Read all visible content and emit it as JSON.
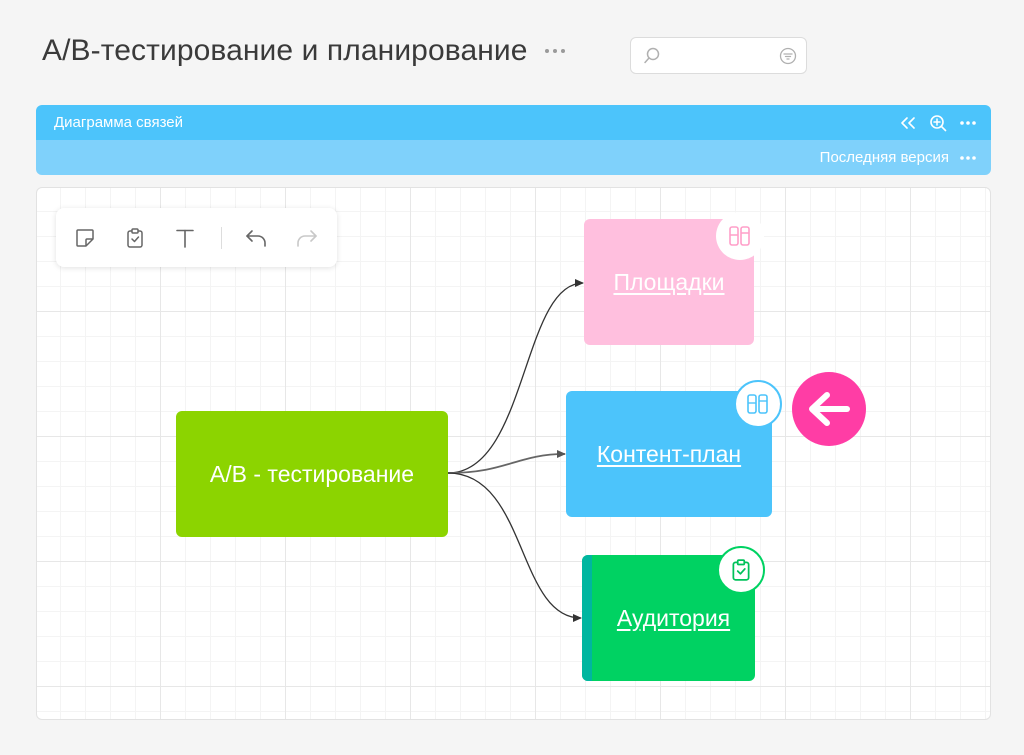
{
  "page": {
    "title": "A/B-тестирование и планирование",
    "more_icon": "more-dots-icon"
  },
  "search": {
    "value": "",
    "placeholder": "",
    "icon": "search-icon",
    "filter_icon": "filter-icon"
  },
  "widget": {
    "title": "Диаграмма связей",
    "actions": [
      "collapse-icon",
      "zoom-in-icon",
      "more-dots-icon"
    ],
    "version_label": "Последняя версия",
    "accent": "#4cc4fb",
    "accent_light": "#7fd1fb"
  },
  "toolbar": {
    "tools": [
      "sticky-note-icon",
      "task-clipboard-icon",
      "text-icon",
      "undo-icon",
      "redo-icon"
    ]
  },
  "diagram": {
    "root": {
      "label": "A/B - тестирование",
      "color": "#8cd400"
    },
    "children": [
      {
        "label": "Площадки",
        "color": "#ffbfde",
        "badge_color": "#ff9fc9",
        "badge_icon": "board-columns-icon"
      },
      {
        "label": "Контент-план",
        "color": "#4cc4fb",
        "badge_color": "#4cc4fb",
        "badge_icon": "board-columns-icon"
      },
      {
        "label": "Аудитория",
        "color": "#00d262",
        "stripe_color": "#00b6a0",
        "badge_color": "#00d262",
        "badge_icon": "task-clipboard-icon"
      }
    ],
    "back_button": {
      "icon": "arrow-left-icon",
      "color": "#ff3da5"
    }
  }
}
